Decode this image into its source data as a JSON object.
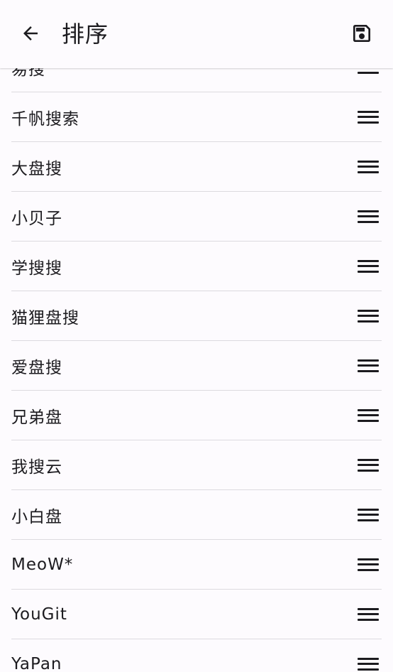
{
  "header": {
    "title": "排序",
    "back_icon": "arrow-left-icon",
    "save_icon": "save-icon"
  },
  "items": [
    {
      "label": "易搜"
    },
    {
      "label": "千帆搜索"
    },
    {
      "label": "大盘搜"
    },
    {
      "label": "小贝子"
    },
    {
      "label": "学搜搜"
    },
    {
      "label": "猫狸盘搜"
    },
    {
      "label": "爱盘搜"
    },
    {
      "label": "兄弟盘"
    },
    {
      "label": "我搜云"
    },
    {
      "label": "小白盘"
    },
    {
      "label": "MeoW*"
    },
    {
      "label": "YouGit"
    },
    {
      "label": "YaPan"
    }
  ],
  "colors": {
    "background": "#fdfbfe",
    "text": "#1c1b1f",
    "divider": "#dcdadf"
  }
}
